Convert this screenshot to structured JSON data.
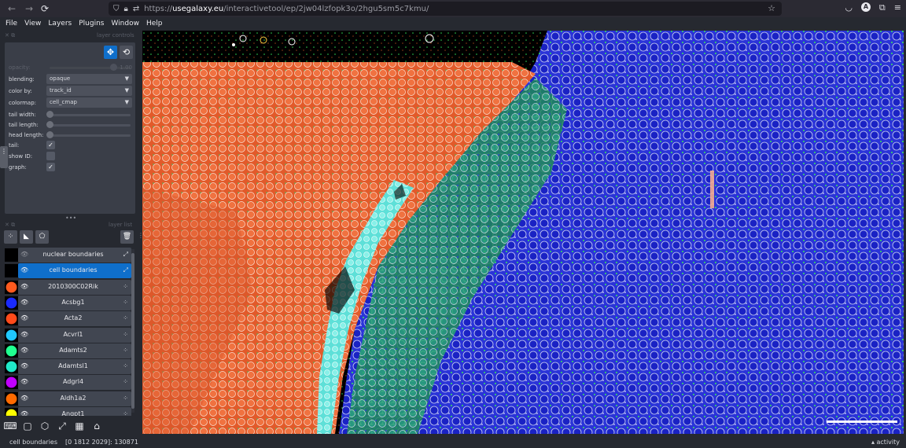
{
  "browser": {
    "url_prefix": "https://",
    "url_domain": "usegalaxy.eu",
    "url_path": "/interactivetool/ep/2jw04lzfopk3o/2hgu5sm5c7kmu/",
    "avatar_letter": "A"
  },
  "menu": [
    "File",
    "View",
    "Layers",
    "Plugins",
    "Window",
    "Help"
  ],
  "layer_controls": {
    "title": "layer controls",
    "opacity_label": "opacity:",
    "opacity_value": "1.00",
    "blending_label": "blending:",
    "blending_value": "opaque",
    "color_by_label": "color by:",
    "color_by_value": "track_id",
    "colormap_label": "colormap:",
    "colormap_value": "cell_cmap",
    "tail_width_label": "tail width:",
    "tail_length_label": "tail length:",
    "head_length_label": "head length:",
    "tail_label": "tail:",
    "tail_checked": true,
    "show_id_label": "show ID:",
    "show_id_checked": false,
    "graph_label": "graph:",
    "graph_checked": true
  },
  "layer_list": {
    "title": "layer list",
    "layers": [
      {
        "name": "nuclear boundaries",
        "color": "#000000",
        "visible": false,
        "selected": false,
        "kind": "tracks"
      },
      {
        "name": "cell boundaries",
        "color": "#000000",
        "visible": true,
        "selected": true,
        "kind": "tracks"
      },
      {
        "name": "2010300C02Rik",
        "color": "#ff5a1e",
        "visible": true,
        "selected": false,
        "kind": "points"
      },
      {
        "name": "Acsbg1",
        "color": "#1a2aff",
        "visible": true,
        "selected": false,
        "kind": "points"
      },
      {
        "name": "Acta2",
        "color": "#ff4a1a",
        "visible": true,
        "selected": false,
        "kind": "points"
      },
      {
        "name": "Acvrl1",
        "color": "#20c8ff",
        "visible": true,
        "selected": false,
        "kind": "points"
      },
      {
        "name": "Adamts2",
        "color": "#20ff90",
        "visible": true,
        "selected": false,
        "kind": "points"
      },
      {
        "name": "Adamtsl1",
        "color": "#20e8c8",
        "visible": true,
        "selected": false,
        "kind": "points"
      },
      {
        "name": "Adgrl4",
        "color": "#c000ff",
        "visible": true,
        "selected": false,
        "kind": "points"
      },
      {
        "name": "Aldh1a2",
        "color": "#ff6a00",
        "visible": true,
        "selected": false,
        "kind": "points"
      },
      {
        "name": "Angpt1",
        "color": "#ffff00",
        "visible": true,
        "selected": false,
        "kind": "points"
      }
    ]
  },
  "status": {
    "layer": "cell boundaries",
    "coords": "[0 1812 2029]: 130871",
    "activity": "activity"
  }
}
